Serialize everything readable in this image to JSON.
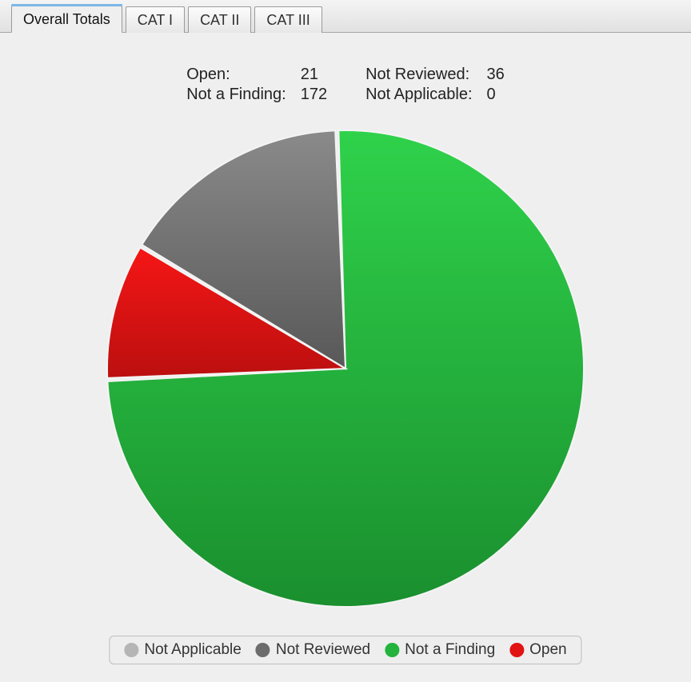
{
  "tabs": [
    {
      "label": "Overall Totals",
      "key": "overall",
      "active": true
    },
    {
      "label": "CAT I",
      "key": "cat1",
      "active": false
    },
    {
      "label": "CAT II",
      "key": "cat2",
      "active": false
    },
    {
      "label": "CAT III",
      "key": "cat3",
      "active": false
    }
  ],
  "stats": {
    "open": {
      "label": "Open:",
      "value": 21
    },
    "naf": {
      "label": "Not a Finding:",
      "value": 172
    },
    "nr": {
      "label": "Not Reviewed:",
      "value": 36
    },
    "na": {
      "label": "Not Applicable:",
      "value": 0
    }
  },
  "legend": [
    {
      "key": "na",
      "label": "Not Applicable",
      "color": "#b5b5b5"
    },
    {
      "key": "nr",
      "label": "Not Reviewed",
      "color": "#6c6c6c"
    },
    {
      "key": "naf",
      "label": "Not a Finding",
      "color": "#24b33c"
    },
    {
      "key": "open",
      "label": "Open",
      "color": "#e11313"
    }
  ],
  "chart_data": {
    "type": "pie",
    "title": "Overall Totals",
    "slices": [
      {
        "label": "Not a Finding",
        "value": 172,
        "color_top": "#2fd24b",
        "color_bot": "#1a8f2e"
      },
      {
        "label": "Open",
        "value": 21,
        "color_top": "#f61616",
        "color_bot": "#bb0f0f"
      },
      {
        "label": "Not Reviewed",
        "value": 36,
        "color_top": "#8a8a8a",
        "color_bot": "#585858"
      },
      {
        "label": "Not Applicable",
        "value": 0,
        "color_top": "#cfcfcf",
        "color_bot": "#9f9f9f"
      }
    ],
    "start_angle_deg": 91.67,
    "direction": "clockwise",
    "slice_gap_deg": 0.8
  }
}
